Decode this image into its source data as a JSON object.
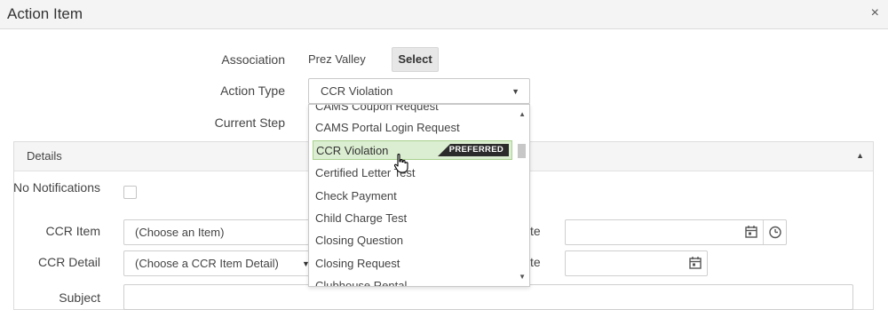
{
  "window": {
    "title": "Action Item",
    "close_label": "×"
  },
  "form": {
    "association_label": "Association",
    "association_value": "Prez Valley",
    "select_button": "Select",
    "action_type_label": "Action Type",
    "action_type_value": "CCR Violation",
    "current_step_label": "Current Step"
  },
  "details": {
    "title": "Details",
    "no_notifications_label": "No Notifications",
    "ccr_item_label": "CCR Item",
    "ccr_item_value": "(Choose an Item)",
    "ccr_detail_label": "CCR Detail",
    "ccr_detail_value": "(Choose a CCR Item Detail)",
    "date_label_1": "te",
    "date_label_2": "te",
    "subject_label": "Subject"
  },
  "dropdown": {
    "options": [
      "CAMS Coupon Request",
      "CAMS Portal Login Request",
      "CCR Violation",
      "Certified Letter Test",
      "Check Payment",
      "Child Charge Test",
      "Closing Question",
      "Closing Request",
      "Clubhouse Rental"
    ],
    "selected": "CCR Violation",
    "preferred_badge": "PREFERRED"
  },
  "icons": {
    "calendar": "calendar-icon",
    "clock": "clock-icon",
    "caret": "caret-down-icon",
    "collapse": "caret-up-icon",
    "cursor": "hand-cursor-icon"
  },
  "colors": {
    "highlight_bg": "#dbeed1",
    "highlight_border": "#a9d08f",
    "badge_bg": "#2b2b2b"
  }
}
